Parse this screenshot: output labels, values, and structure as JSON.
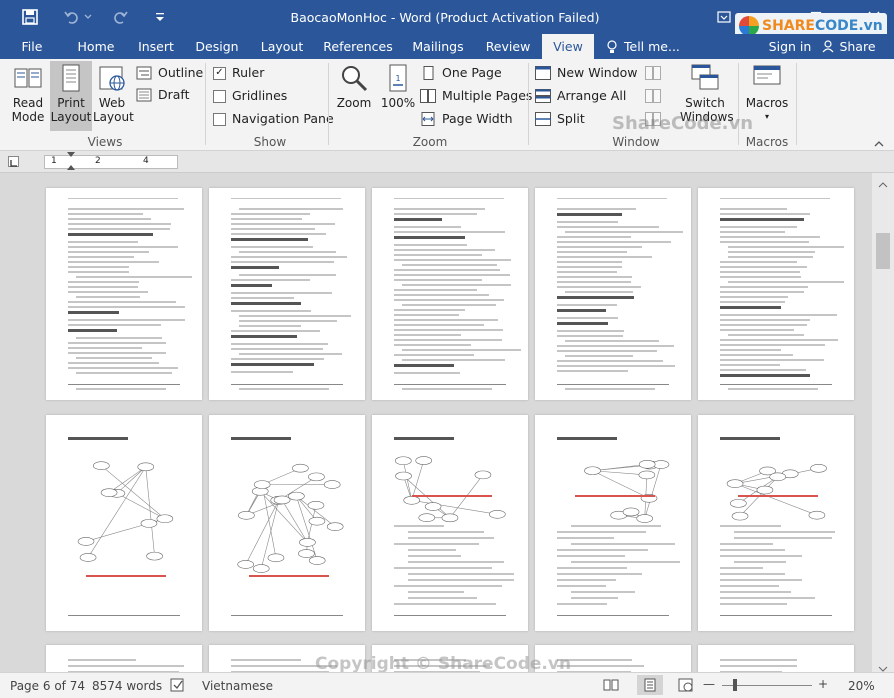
{
  "title": "BaocaoMonHoc - Word (Product Activation Failed)",
  "tabs": [
    "File",
    "Home",
    "Insert",
    "Design",
    "Layout",
    "References",
    "Mailings",
    "Review",
    "View"
  ],
  "tell_me": "Tell me...",
  "sign_in": "Sign in",
  "share": "Share",
  "logo": {
    "part1": "SHARE",
    "part2": "CODE",
    "part3": ".vn"
  },
  "ribbon": {
    "views": {
      "read_mode_1": "Read",
      "read_mode_2": "Mode",
      "print_layout_1": "Print",
      "print_layout_2": "Layout",
      "web_layout_1": "Web",
      "web_layout_2": "Layout",
      "outline": "Outline",
      "draft": "Draft",
      "label": "Views"
    },
    "show": {
      "ruler": "Ruler",
      "gridlines": "Gridlines",
      "navigation_pane": "Navigation Pane",
      "label": "Show",
      "ruler_checked": true,
      "gridlines_checked": false,
      "navigation_checked": false
    },
    "zoom": {
      "zoom": "Zoom",
      "percent": "100%",
      "one_page": "One Page",
      "multiple_pages": "Multiple Pages",
      "page_width": "Page Width",
      "label": "Zoom"
    },
    "window": {
      "new_window": "New Window",
      "arrange_all": "Arrange All",
      "split": "Split",
      "switch_1": "Switch",
      "switch_2": "Windows",
      "label": "Window"
    },
    "macros": {
      "macros": "Macros",
      "label": "Macros"
    }
  },
  "ruler": {
    "n1": "1",
    "n2": "2",
    "n4": "4"
  },
  "status": {
    "page": "Page 6 of 74",
    "words": "8574 words",
    "language": "Vietnamese",
    "zoom": "20%"
  },
  "watermark1": "ShareCode.vn",
  "watermark2": "Copyright © ShareCode.vn",
  "colors": {
    "accent": "#2b579a",
    "ribbon_bg": "#f3f3f3",
    "doc_bg": "#d9d9d9"
  }
}
